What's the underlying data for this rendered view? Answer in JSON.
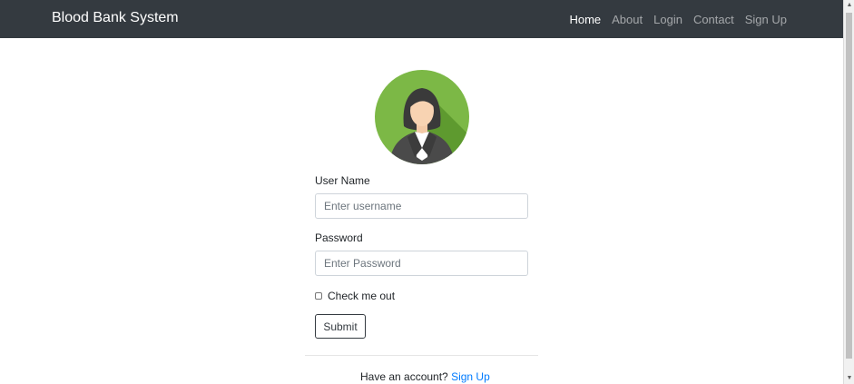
{
  "navbar": {
    "brand": "Blood Bank System",
    "links": [
      {
        "label": "Home",
        "active": true
      },
      {
        "label": "About",
        "active": false
      },
      {
        "label": "Login",
        "active": false
      },
      {
        "label": "Contact",
        "active": false
      },
      {
        "label": "Sign Up",
        "active": false
      }
    ]
  },
  "avatar": {
    "icon": "user-avatar-icon"
  },
  "form": {
    "username_label": "User Name",
    "username_placeholder": "Enter username",
    "username_value": "",
    "password_label": "Password",
    "password_placeholder": "Enter Password",
    "password_value": "",
    "remember_label": "Check me out",
    "remember_checked": false,
    "submit_label": "Submit"
  },
  "footer": {
    "prompt": "Have an account?",
    "link_label": "Sign Up"
  },
  "colors": {
    "navbar_bg": "#343a40",
    "avatar_bg": "#7cb846",
    "link": "#007bff"
  }
}
